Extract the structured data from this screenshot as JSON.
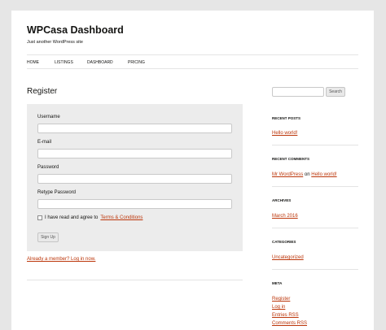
{
  "site": {
    "title": "WPCasa Dashboard",
    "description": "Just another WordPress site"
  },
  "nav": {
    "items": [
      "HOME",
      "LISTINGS",
      "DASHBOARD",
      "PRICING"
    ]
  },
  "main": {
    "title": "Register",
    "fields": [
      {
        "label": "Username",
        "value": ""
      },
      {
        "label": "E-mail",
        "value": ""
      },
      {
        "label": "Password",
        "value": ""
      },
      {
        "label": "Retype Password",
        "value": ""
      }
    ],
    "terms": {
      "prefix": "I have read and agree to",
      "link": "Terms & Conditions",
      "checked": false
    },
    "signup_label": "Sign Up",
    "already_member": "Already a member? Log in now."
  },
  "sidebar": {
    "search": {
      "placeholder": "",
      "button": "Search"
    },
    "recent_posts": {
      "title": "RECENT POSTS",
      "items": [
        "Hello world!"
      ]
    },
    "recent_comments": {
      "title": "RECENT COMMENTS",
      "author": "Mr WordPress",
      "on": "on",
      "post": "Hello world!"
    },
    "archives": {
      "title": "ARCHIVES",
      "items": [
        "March 2016"
      ]
    },
    "categories": {
      "title": "CATEGORIES",
      "items": [
        "Uncategorized"
      ]
    },
    "meta": {
      "title": "META",
      "items": [
        "Register",
        "Log in",
        "Entries RSS",
        "Comments RSS"
      ]
    }
  },
  "colors": {
    "link": "#bc360a",
    "form_bg": "#ececec",
    "page_bg": "#e6e6e6"
  }
}
